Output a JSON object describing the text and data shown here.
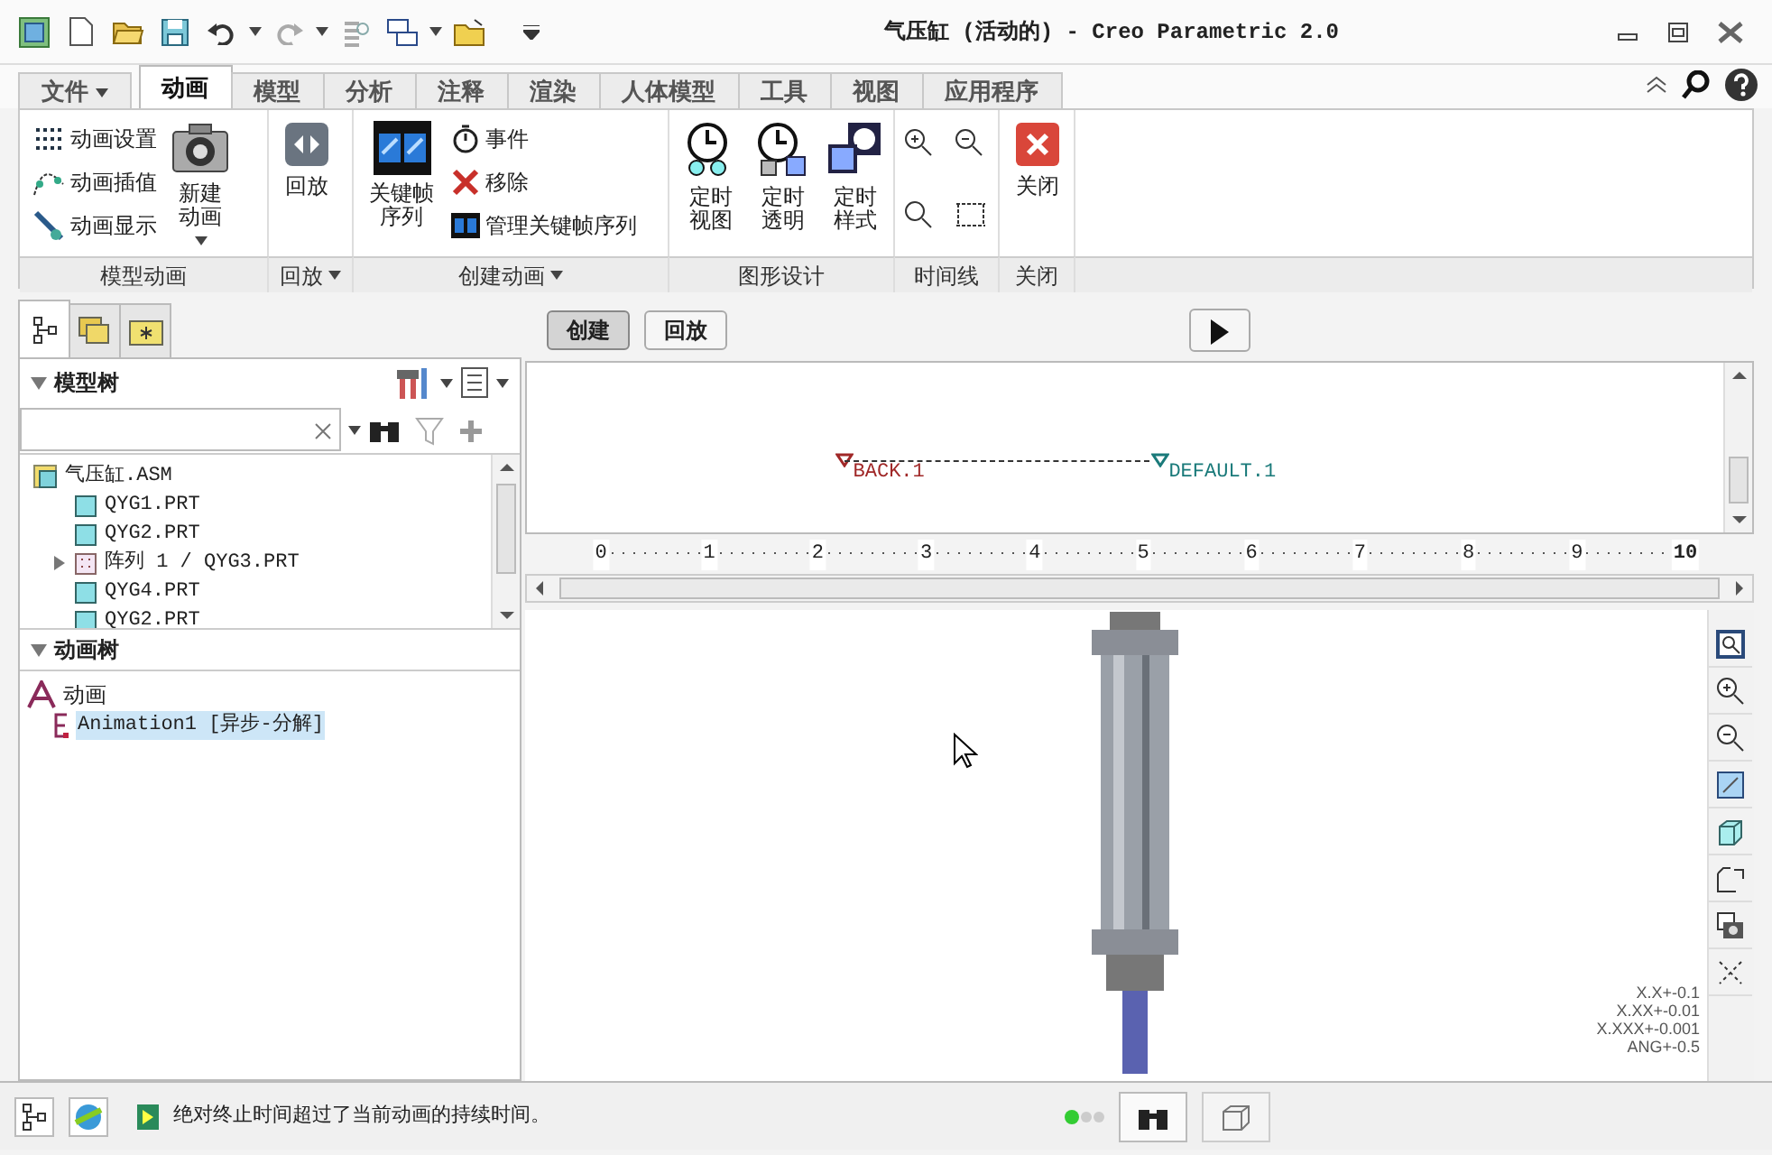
{
  "window": {
    "title": "气压缸 (活动的) - Creo Parametric 2.0"
  },
  "ribbon_tabs": [
    {
      "label": "文件",
      "kind": "menu",
      "selected": false
    },
    {
      "label": "动画",
      "kind": "tab",
      "selected": true
    },
    {
      "label": "模型",
      "kind": "tab",
      "selected": false
    },
    {
      "label": "分析",
      "kind": "tab",
      "selected": false
    },
    {
      "label": "注释",
      "kind": "tab",
      "selected": false
    },
    {
      "label": "渲染",
      "kind": "tab",
      "selected": false
    },
    {
      "label": "人体模型",
      "kind": "tab",
      "selected": false
    },
    {
      "label": "工具",
      "kind": "tab",
      "selected": false
    },
    {
      "label": "视图",
      "kind": "tab",
      "selected": false
    },
    {
      "label": "应用程序",
      "kind": "tab",
      "selected": false
    }
  ],
  "ribbon_groups": [
    {
      "label": "模型动画",
      "dropdown": false,
      "commands": [
        {
          "label": "动画设置",
          "kind": "small",
          "dropdown": false
        },
        {
          "label": "动画插值",
          "kind": "small",
          "dropdown": false
        },
        {
          "label": "动画显示",
          "kind": "small",
          "dropdown": false
        },
        {
          "label": "新建动画",
          "kind": "large",
          "dropdown": true
        }
      ]
    },
    {
      "label": "回放",
      "dropdown": true,
      "commands": [
        {
          "label": "回放",
          "kind": "large",
          "dropdown": false
        }
      ]
    },
    {
      "label": "创建动画",
      "dropdown": true,
      "commands": [
        {
          "label": "关键帧序列",
          "kind": "large",
          "dropdown": false
        },
        {
          "label": "事件",
          "kind": "small",
          "dropdown": false
        },
        {
          "label": "移除",
          "kind": "small",
          "dropdown": false
        },
        {
          "label": "管理关键帧序列",
          "kind": "small",
          "dropdown": false
        }
      ]
    },
    {
      "label": "图形设计",
      "dropdown": false,
      "commands": [
        {
          "label": "定时视图",
          "kind": "large",
          "dropdown": false
        },
        {
          "label": "定时透明",
          "kind": "large",
          "dropdown": false
        },
        {
          "label": "定时样式",
          "kind": "large",
          "dropdown": false
        }
      ]
    },
    {
      "label": "时间线",
      "dropdown": false,
      "commands": [
        {
          "kind": "icon"
        },
        {
          "kind": "icon"
        },
        {
          "kind": "icon"
        },
        {
          "kind": "icon"
        }
      ]
    },
    {
      "label": "关闭",
      "dropdown": false,
      "commands": [
        {
          "label": "关闭",
          "kind": "large",
          "dropdown": false
        }
      ]
    }
  ],
  "navigator_tabs": [
    {
      "selected": true
    },
    {
      "selected": false
    },
    {
      "selected": false
    }
  ],
  "model_tree": {
    "title": "模型树",
    "items": [
      {
        "label": "气压缸.ASM",
        "kind": "assembly",
        "children": [
          {
            "label": "QYG1.PRT",
            "kind": "part"
          },
          {
            "label": "QYG2.PRT",
            "kind": "part"
          },
          {
            "label": "阵列 1 / QYG3.PRT",
            "kind": "pattern",
            "expanded": false
          },
          {
            "label": "QYG4.PRT",
            "kind": "part"
          },
          {
            "label": "QYG2.PRT",
            "kind": "part"
          }
        ]
      }
    ]
  },
  "animation_tree": {
    "title": "动画树",
    "items": [
      {
        "label": "动画",
        "kind": "root",
        "children": [
          {
            "label": "Animation1 [异步-分解]",
            "kind": "animation",
            "selected": true
          }
        ]
      }
    ]
  },
  "mode_buttons": [
    {
      "label": "创建",
      "selected": true
    },
    {
      "label": "回放",
      "selected": false
    }
  ],
  "timeline": {
    "keyframes": [
      {
        "label": "BACK.1",
        "color": "#a02828"
      },
      {
        "label": "DEFAULT.1",
        "color": "#1a7a7a"
      }
    ],
    "ruler": [
      "0",
      "1",
      "2",
      "3",
      "4",
      "5",
      "6",
      "7",
      "8",
      "9",
      "10"
    ]
  },
  "tolerances": [
    "X.X+-0.1",
    "X.XX+-0.01",
    "X.XXX+-0.001",
    "ANG+-0.5"
  ],
  "status_bar": {
    "message": "绝对终止时间超过了当前动画的持续时间。"
  }
}
